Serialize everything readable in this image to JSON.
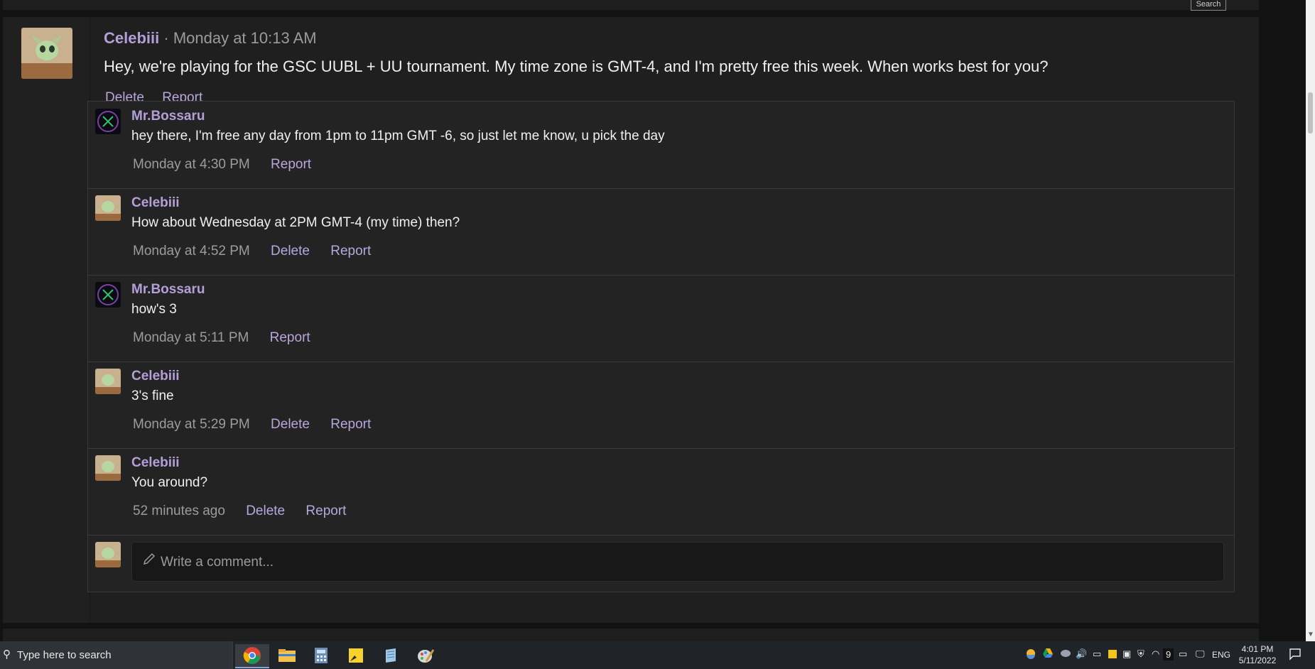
{
  "header": {
    "search_label": "Search"
  },
  "post": {
    "author": "Celebiii",
    "timestamp": "· Monday at 10:13 AM",
    "text": "Hey, we're playing for the GSC UUBL + UU tournament. My time zone is GMT-4, and I'm pretty free this week. When works best for you?",
    "actions": {
      "delete": "Delete",
      "report": "Report"
    }
  },
  "comments": [
    {
      "author": "Mr.Bossaru",
      "text": "hey there, I'm free any day from 1pm to 11pm GMT -6, so just let me know, u pick the day",
      "time": "Monday at 4:30 PM",
      "report": "Report"
    },
    {
      "author": "Celebiii",
      "text": "How about Wednesday at 2PM GMT-4 (my time) then?",
      "time": "Monday at 4:52 PM",
      "delete": "Delete",
      "report": "Report"
    },
    {
      "author": "Mr.Bossaru",
      "text": "how's 3",
      "time": "Monday at 5:11 PM",
      "report": "Report"
    },
    {
      "author": "Celebiii",
      "text": "3's fine",
      "time": "Monday at 5:29 PM",
      "delete": "Delete",
      "report": "Report"
    },
    {
      "author": "Celebiii",
      "text": "You around?",
      "time": "52 minutes ago",
      "delete": "Delete",
      "report": "Report"
    }
  ],
  "composer": {
    "placeholder": "Write a comment..."
  },
  "taskbar": {
    "search_placeholder": "Type here to search",
    "apps": [
      "chrome-icon",
      "file-explorer-icon",
      "calculator-icon",
      "sticky-notes-icon",
      "notepad-icon",
      "paint-icon"
    ],
    "tray_badge": "9",
    "language": "ENG",
    "time": "4:01 PM",
    "date": "5/11/2022"
  },
  "colors": {
    "accent": "#b49fd9",
    "background": "#1e1e1e",
    "link": "#b7a7dc"
  }
}
